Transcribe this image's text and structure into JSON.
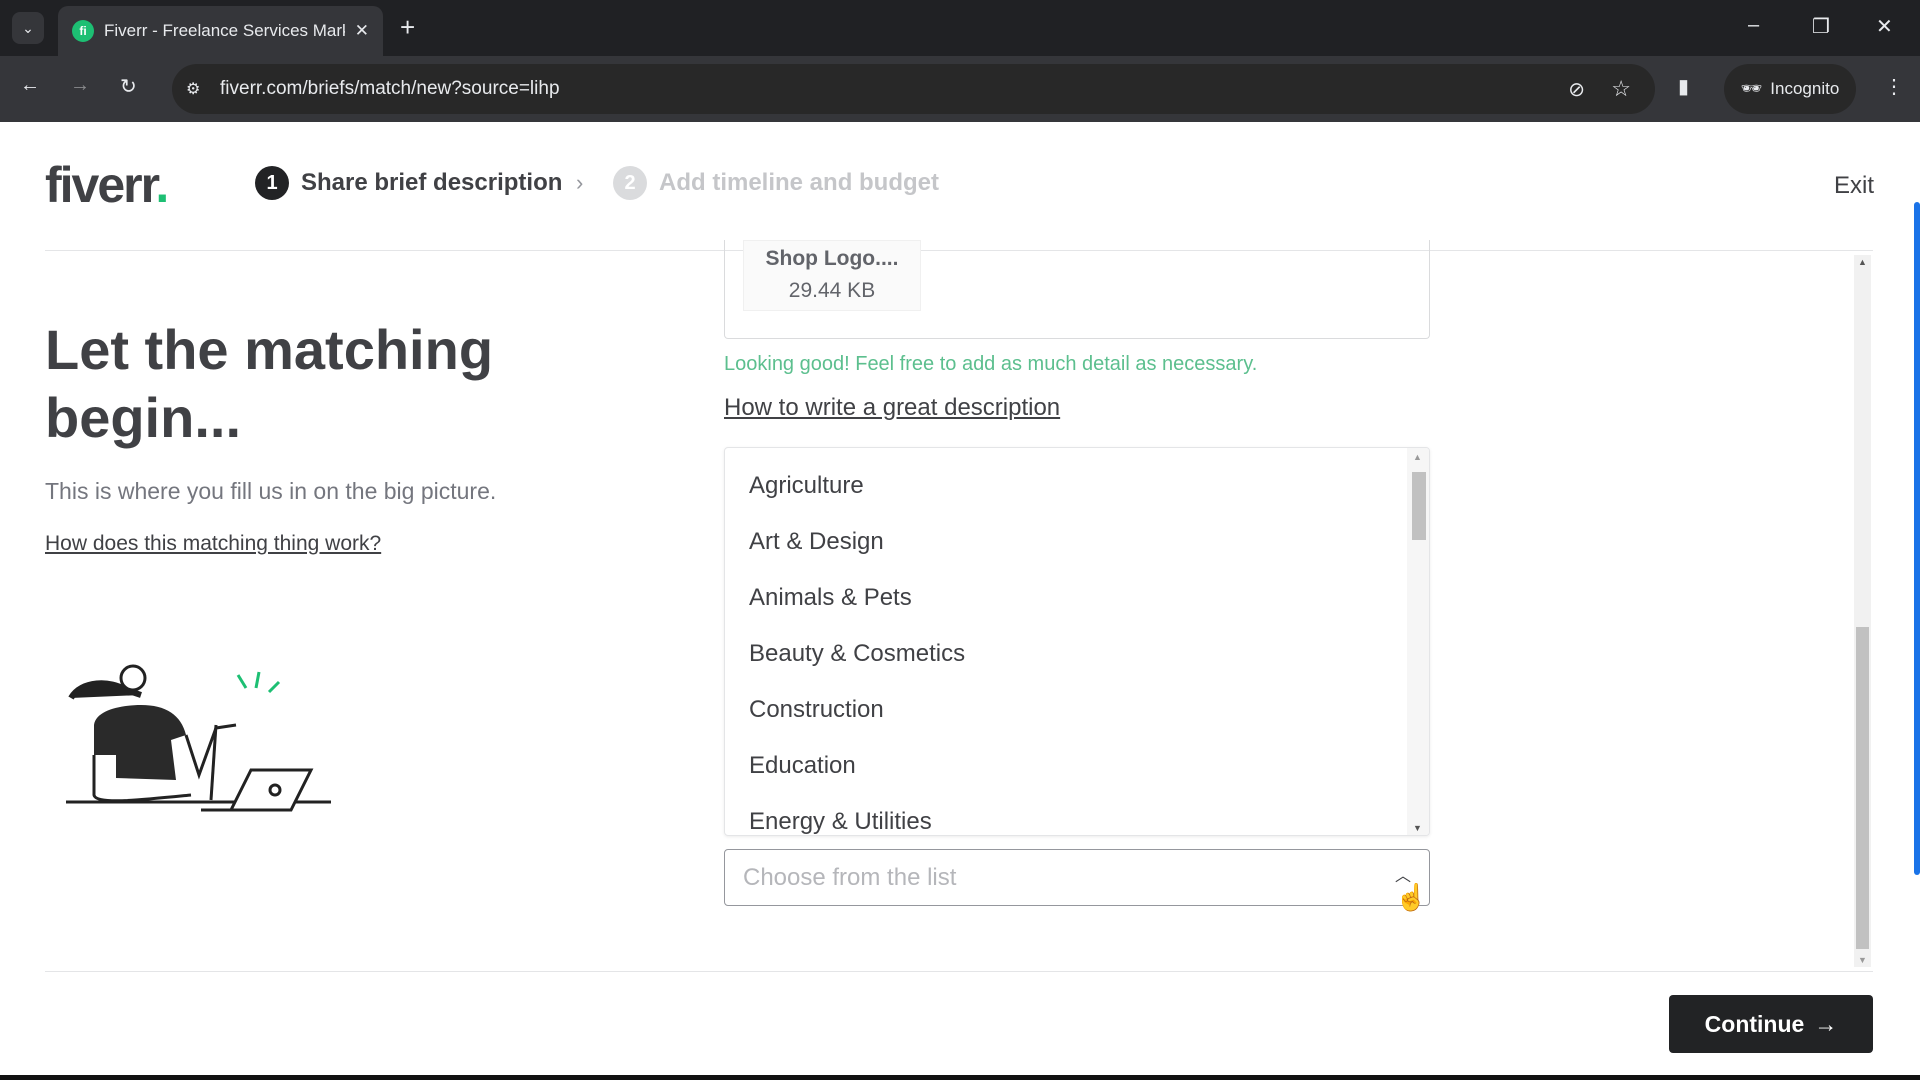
{
  "browser": {
    "tab_title": "Fiverr - Freelance Services Mark",
    "favicon_text": "fi",
    "url": "fiverr.com/briefs/match/new?source=lihp",
    "incognito_label": "Incognito"
  },
  "header": {
    "logo": "fiverr",
    "logo_dot": ".",
    "steps": [
      {
        "number": "1",
        "label": "Share brief description",
        "active": true
      },
      {
        "number": "2",
        "label": "Add timeline and budget",
        "active": false
      }
    ],
    "exit_label": "Exit"
  },
  "left": {
    "title": "Let the matching begin...",
    "subtitle": "This is where you fill us in on the big picture.",
    "help_link": "How does this matching thing work?"
  },
  "main": {
    "attachment": {
      "name": "Shop Logo....",
      "size": "29.44 KB"
    },
    "validation_message": "Looking good! Feel free to add as much detail as necessary.",
    "description_help_link": "How to write a great description",
    "industry_options": [
      "Agriculture",
      "Art & Design",
      "Animals & Pets",
      "Beauty & Cosmetics",
      "Construction",
      "Education",
      "Energy & Utilities"
    ],
    "industry_placeholder": "Choose from the list"
  },
  "footer": {
    "continue_label": "Continue"
  },
  "colors": {
    "brand": "#1dbf73",
    "success_text": "#5cbf8e",
    "text": "#404145",
    "button": "#222325"
  }
}
